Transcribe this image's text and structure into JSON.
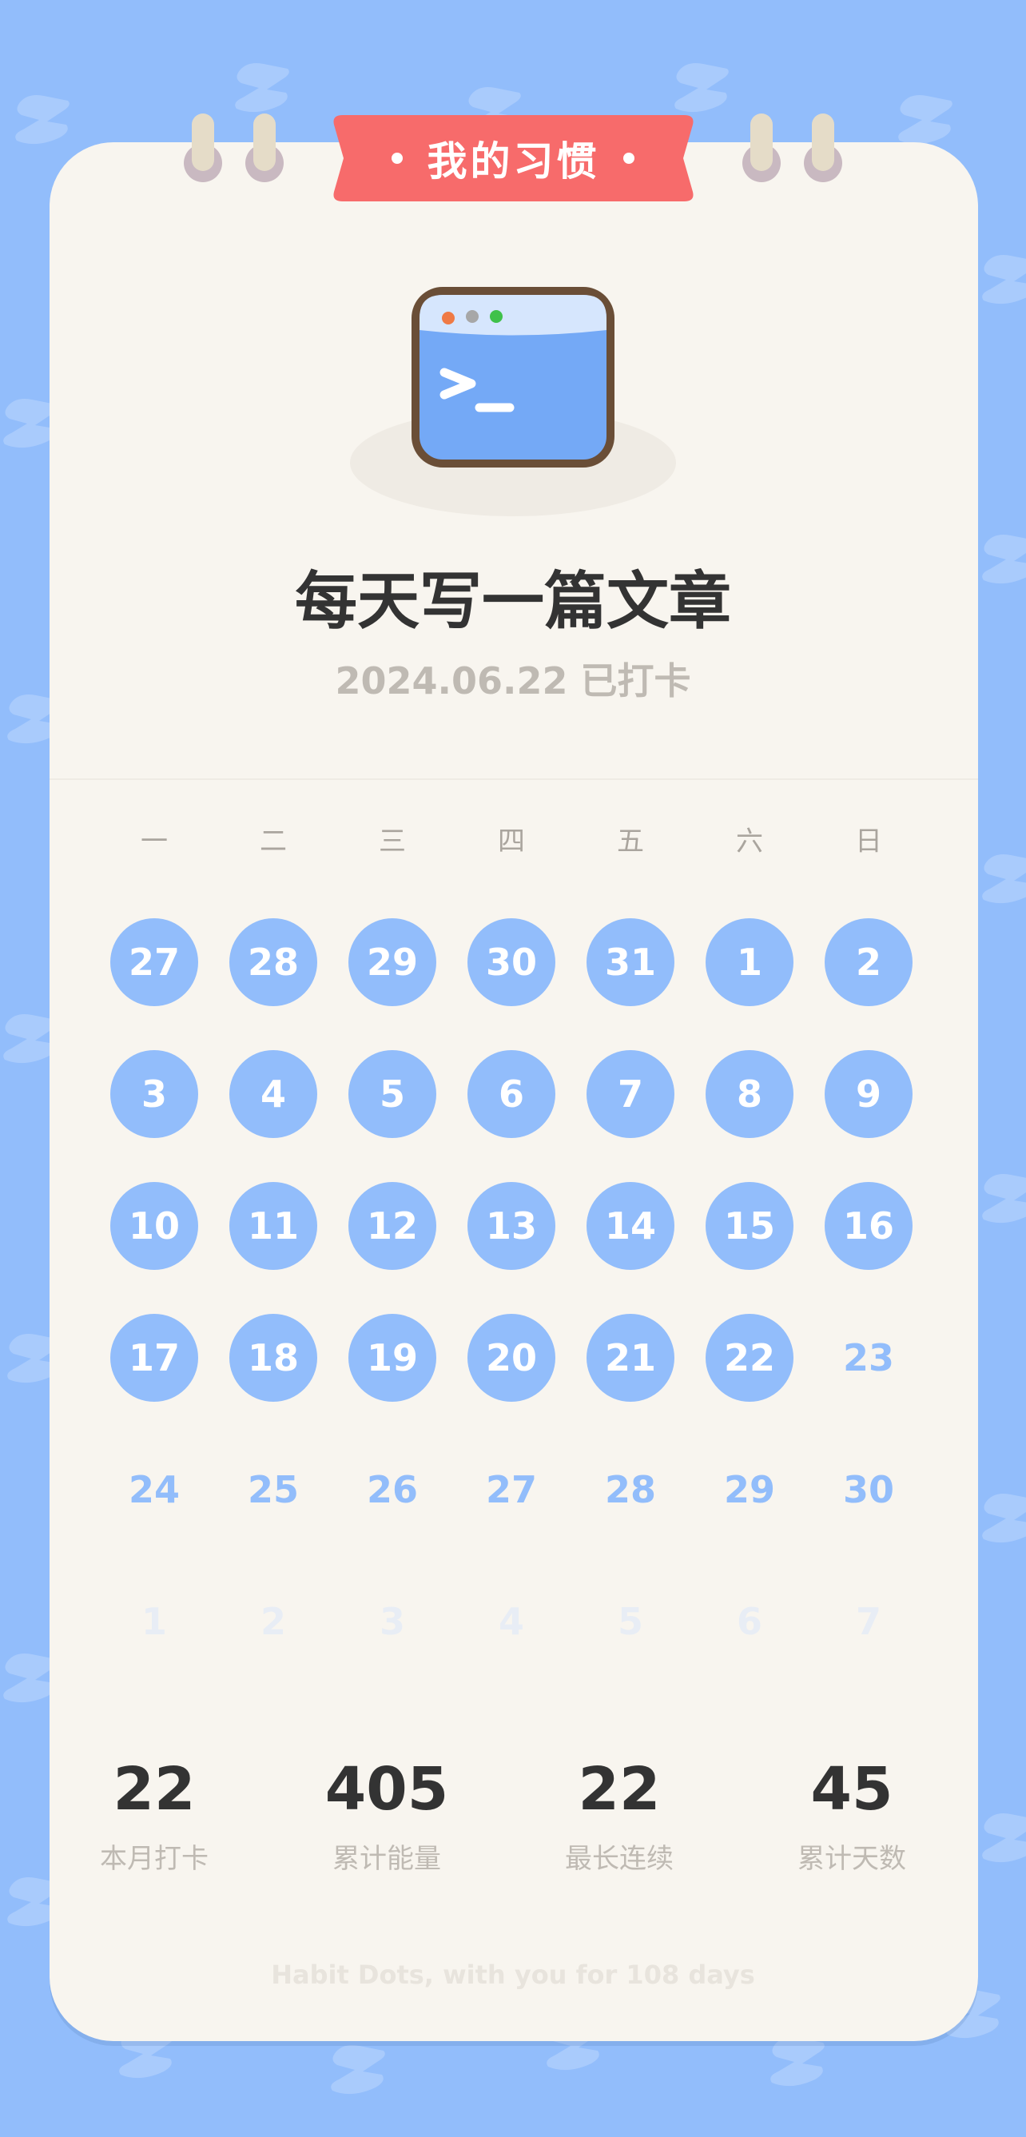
{
  "header": {
    "ribbon_label": "我的习惯"
  },
  "habit": {
    "icon": "terminal-window-icon",
    "title": "每天写一篇文章",
    "checkin_status": "2024.06.22 已打卡"
  },
  "calendar": {
    "weekdays": [
      "一",
      "二",
      "三",
      "四",
      "五",
      "六",
      "日"
    ],
    "weeks": [
      [
        "27",
        "28",
        "29",
        "30",
        "31",
        "1",
        "2"
      ],
      [
        "3",
        "4",
        "5",
        "6",
        "7",
        "8",
        "9"
      ],
      [
        "10",
        "11",
        "12",
        "13",
        "14",
        "15",
        "16"
      ],
      [
        "17",
        "18",
        "19",
        "20",
        "21",
        "22",
        "23"
      ],
      [
        "24",
        "25",
        "26",
        "27",
        "28",
        "29",
        "30"
      ],
      [
        "1",
        "2",
        "3",
        "4",
        "5",
        "6",
        "7"
      ]
    ],
    "states": [
      [
        "filled",
        "filled",
        "filled",
        "filled",
        "filled",
        "filled",
        "filled"
      ],
      [
        "filled",
        "filled",
        "filled",
        "filled",
        "filled",
        "filled",
        "filled"
      ],
      [
        "filled",
        "filled",
        "filled",
        "filled",
        "filled",
        "filled",
        "filled"
      ],
      [
        "filled",
        "filled",
        "filled",
        "filled",
        "filled",
        "filled",
        "future"
      ],
      [
        "future",
        "future",
        "future",
        "future",
        "future",
        "future",
        "future"
      ],
      [
        "next",
        "next",
        "next",
        "next",
        "next",
        "next",
        "next"
      ]
    ]
  },
  "stats": [
    {
      "value": "22",
      "label": "本月打卡"
    },
    {
      "value": "405",
      "label": "累计能量"
    },
    {
      "value": "22",
      "label": "最长连续"
    },
    {
      "value": "45",
      "label": "累计天数"
    }
  ],
  "footer": {
    "text": "Habit Dots, with you for 108 days"
  },
  "colors": {
    "background": "#92bdfb",
    "card": "#f8f5ef",
    "ribbon": "#f76b6b",
    "accent": "#92bdfb",
    "text_dark": "#333333",
    "text_muted": "#bfbab3"
  }
}
